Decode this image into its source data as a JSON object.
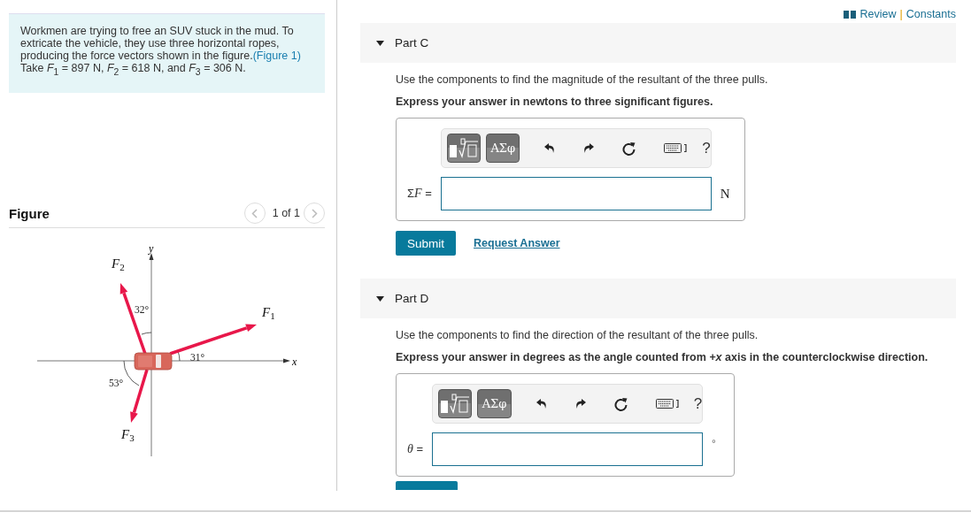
{
  "header": {
    "review": "Review",
    "separator": "|",
    "constants": "Constants"
  },
  "problem": {
    "text_before": "Workmen are trying to free an SUV stuck in the mud. To extricate the vehicle, they use three horizontal ropes, producing the force vectors shown in the figure.",
    "link": "(Figure 1)",
    "text_after": "Take *F*$_{1}$ = 897 N, *F*$_{2}$ = 618 N, and *F*$_{3}$ = 306 N."
  },
  "figure": {
    "title": "Figure",
    "pager": "1 of 1",
    "axes": {
      "x": "x",
      "y": "y"
    },
    "vectors": [
      {
        "name": "F",
        "sub": "1"
      },
      {
        "name": "F",
        "sub": "2"
      },
      {
        "name": "F",
        "sub": "3"
      }
    ],
    "angles": [
      "31°",
      "32°",
      "53°"
    ]
  },
  "parts": [
    {
      "title": "Part C",
      "expanded": true,
      "prompt": "Use the components to find the magnitude of the resultant of the three pulls.",
      "instruction": "Express your answer in newtons to three significant figures.",
      "symbols": "ΑΣφ",
      "help": "?",
      "label": {
        "symbol": "Σ",
        "variable": "F",
        "sign": "="
      },
      "unit": "N",
      "submit": "Submit",
      "request": "Request Answer"
    },
    {
      "title": "Part D",
      "expanded": true,
      "prompt": "Use the components to find the direction of the resultant of the three pulls.",
      "instruction": "Express your answer in degrees as the angle counted from *+x* axis in the counterclockwise direction.",
      "symbols": "ΑΣφ",
      "help": "?",
      "label": {
        "variable": "θ",
        "sign": "="
      },
      "unit": "°"
    }
  ]
}
